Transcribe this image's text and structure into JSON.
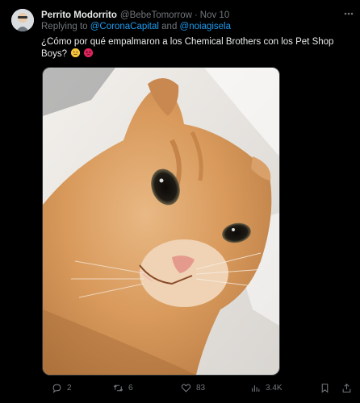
{
  "tweet": {
    "display_name": "Perrito Modorrito",
    "handle": "@BebeTomorrow",
    "separator": "·",
    "date": "Nov 10",
    "reply_prefix": "Replying to",
    "mentions": [
      "@CoronaCapital",
      "@noiagisela"
    ],
    "reply_and": "and",
    "text": "¿Cómo por qué empalmaron a los Chemical Brothers con los Pet Shop Boys?",
    "emojis": [
      "thinking-face-icon",
      "angry-face-icon"
    ]
  },
  "actions": {
    "replies": "2",
    "retweets": "6",
    "likes": "83",
    "views": "3.4K"
  },
  "colors": {
    "background": "#000000",
    "text": "#e7e9ea",
    "muted": "#71767b",
    "link": "#1d9bf0"
  }
}
